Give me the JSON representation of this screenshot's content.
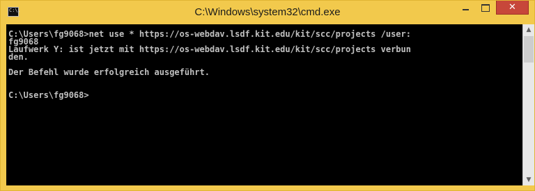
{
  "window": {
    "title": "C:\\Windows\\system32\\cmd.exe",
    "icon_text": "C:\\.",
    "close_glyph": "✕",
    "accent_color": "#f2c94c",
    "close_color": "#c7473a"
  },
  "console": {
    "background": "#000000",
    "text_color": "#c0c0c0",
    "lines": [
      "C:\\Users\\fg9068>net use * https://os-webdav.lsdf.kit.edu/kit/scc/projects /user:",
      "fg9068",
      "Laufwerk Y: ist jetzt mit https://os-webdav.lsdf.kit.edu/kit/scc/projects verbun",
      "den.",
      "",
      "Der Befehl wurde erfolgreich ausgeführt.",
      "",
      "",
      "C:\\Users\\fg9068>"
    ]
  },
  "scrollbar": {
    "up_glyph": "▲",
    "down_glyph": "▼"
  }
}
